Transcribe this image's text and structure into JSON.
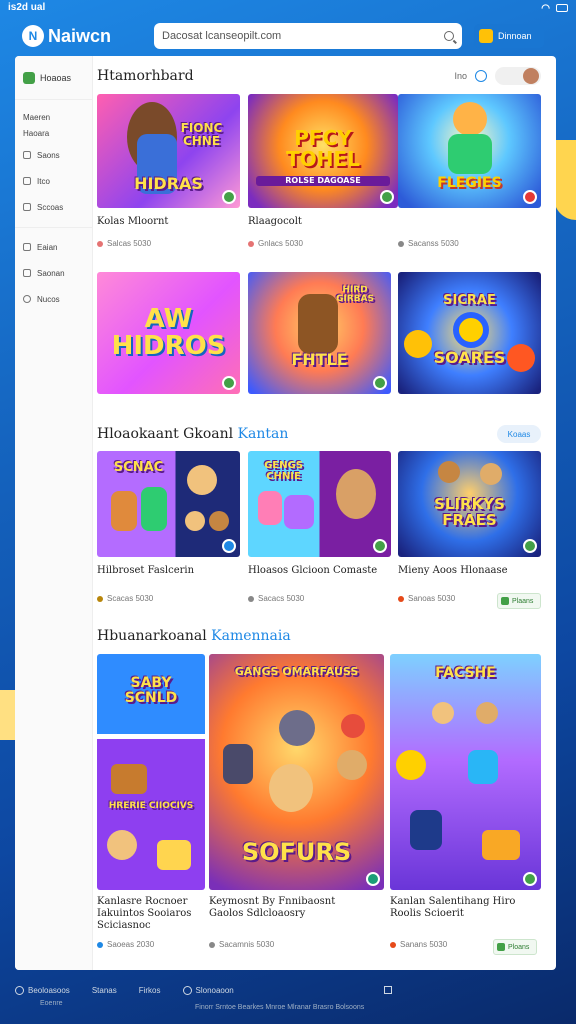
{
  "status": {
    "time": "is2d",
    "carrier": "ual"
  },
  "app": {
    "name": "Naiwcn",
    "logo_letter": "N"
  },
  "search": {
    "placeholder": "Dacosat lcanseopilt.com"
  },
  "top_button": {
    "label": "Dinnoan"
  },
  "sidebar": {
    "home": "Hoaoas",
    "section_label_1": "Maeren",
    "section_label_2": "Haoara",
    "items": [
      "Saons",
      "Itco",
      "Sccoas",
      "Eaian",
      "Saonan",
      "Nucos"
    ]
  },
  "sections": [
    {
      "title": "Htamorhbard",
      "accent": "",
      "tools": {
        "label": "Ino"
      },
      "cards": [
        {
          "art_text": "HIDRAS",
          "art_sub": "FIONC CHNE",
          "title": "Kolas Mloornt",
          "meta": "Salcas 5030",
          "badge": "green"
        },
        {
          "art_text": "PFCY TOHEL",
          "art_sub": "ROLSE DAGOASE",
          "title": "Rlaagocolt",
          "meta": "Gnlacs 5030",
          "badge": "green"
        },
        {
          "art_text": "FLEGIES",
          "art_sub": "",
          "title": "",
          "meta": "Sacanss 5030",
          "badge": "red"
        },
        {
          "art_text": "AW HIDROS",
          "art_sub": "",
          "title": "",
          "meta": "",
          "badge": "green"
        },
        {
          "art_text": "FHTLE",
          "art_sub": "HIRD GIRBAS",
          "title": "",
          "meta": "",
          "badge": "green"
        },
        {
          "art_text": "SOARES",
          "art_sub": "SICRAE",
          "title": "",
          "meta": "",
          "badge": ""
        }
      ]
    },
    {
      "title": "Hloaokaant Gkoanl",
      "accent": "Kantan",
      "see_all": "Koaas",
      "cards": [
        {
          "art_text": "SCNAC",
          "art_sub": "",
          "title": "Hilbroset Faslcerin",
          "meta": "Scacas 5030",
          "badge": "blue"
        },
        {
          "art_text": "GENGS CHNIE",
          "art_sub": "",
          "title": "Hloasos Glcioon Comaste",
          "meta": "Sacacs 5030",
          "badge": "green"
        },
        {
          "art_text": "SLIRKYS FRAES",
          "art_sub": "",
          "title": "Mieny Aoos Hlonaase",
          "meta": "Sanoas 5030",
          "badge": "green",
          "button": "Plaans"
        }
      ]
    },
    {
      "title": "Hbuanarkoanal",
      "accent": "Kamennaia",
      "cards": [
        {
          "art_text": "SABY SCNLD",
          "art_sub": "HRERIE CIIOCIVS",
          "title": "Kanlasre Rocnoer Iakuintos Sooiaros Sciciasnoc",
          "meta": "Saoeas 2030",
          "badge": ""
        },
        {
          "art_text": "SOFURS",
          "art_sub": "GANGS OMARFAUSS",
          "title": "Keymosnt By Fnnibaosnt Gaolos Sdlcloaosry",
          "meta": "Sacamnis 5030",
          "badge": "green"
        },
        {
          "art_text": "FACSHE",
          "art_sub": "",
          "title": "Kanlan Salentihang Hiro Roolis Scioerit",
          "meta": "Sanans 5030",
          "badge": "green",
          "button": "Ploans"
        }
      ]
    }
  ],
  "footer": {
    "items": [
      "Beoloasoos",
      "Stanas",
      "Firkos",
      "Slonoaoon"
    ],
    "sub": "Eoenre",
    "copy": "Finorr Srntoe Bearkes Mnroe Mlranar Brasro Bolsoons"
  }
}
